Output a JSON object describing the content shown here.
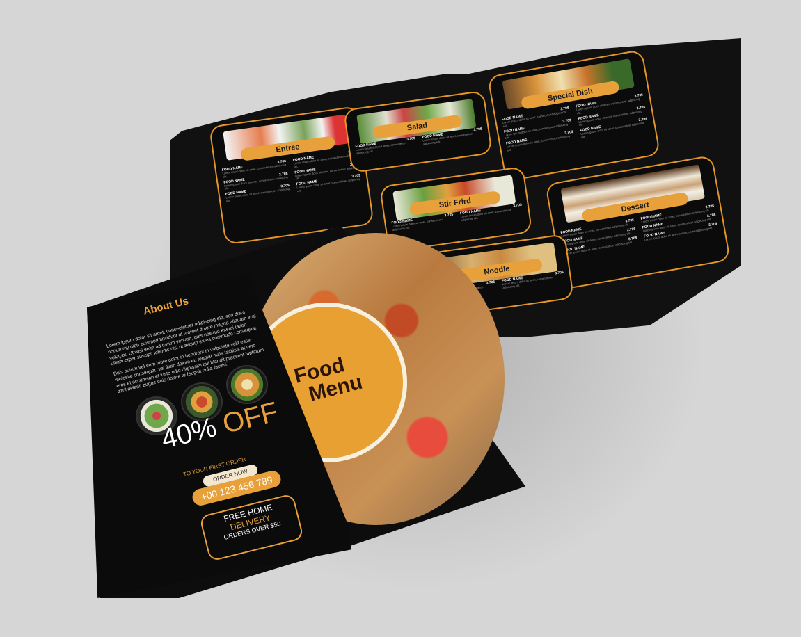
{
  "brochure": {
    "title_line1": "Food",
    "title_line2": "Menu",
    "about": {
      "title": "About Us",
      "text1": "Lorem ipsum dolor sit amet, consectetuer adipiscing elit, sed diam nonummy nibh euismod tincidunt ut laoreet dolore magna aliquam erat volutpat. Ut wisi enim ad minim veniam, quis nostrud exerci tation ullamcorper suscipit lobortis nisl ut aliquip ex ea commodo consequat.",
      "text2": "Duis autem vel eum iriure dolor in hendrerit in vulputate velit esse molestie consequat, vel illum dolore eu feugiat nulla facilisis at vero eros et accumsan et iusto odio dignissim qui blandit praesent luptatum zzril delenit augue duis dolore te feugait nulla facilisi."
    },
    "promo": {
      "discount_number": "40%",
      "discount_off": "OFF",
      "subtitle": "TO YOUR FIRST ORDER",
      "order_label": "ORDER NOW",
      "phone": "+00 123 456 789",
      "delivery_line1": "FREE HOME",
      "delivery_line2": "DELIVERY",
      "delivery_line3": "ORDERS OVER $50"
    },
    "sections": [
      {
        "title": "Entree"
      },
      {
        "title": "Salad"
      },
      {
        "title": "Special Dish"
      },
      {
        "title": "Stir Frird"
      },
      {
        "title": "Noodle"
      },
      {
        "title": "Dessert"
      }
    ],
    "item_name": "FOOD NAME",
    "item_price": "3.70$",
    "item_desc": "Lorem ipsum dolor sit amet, consectetuer adipiscing elit."
  }
}
